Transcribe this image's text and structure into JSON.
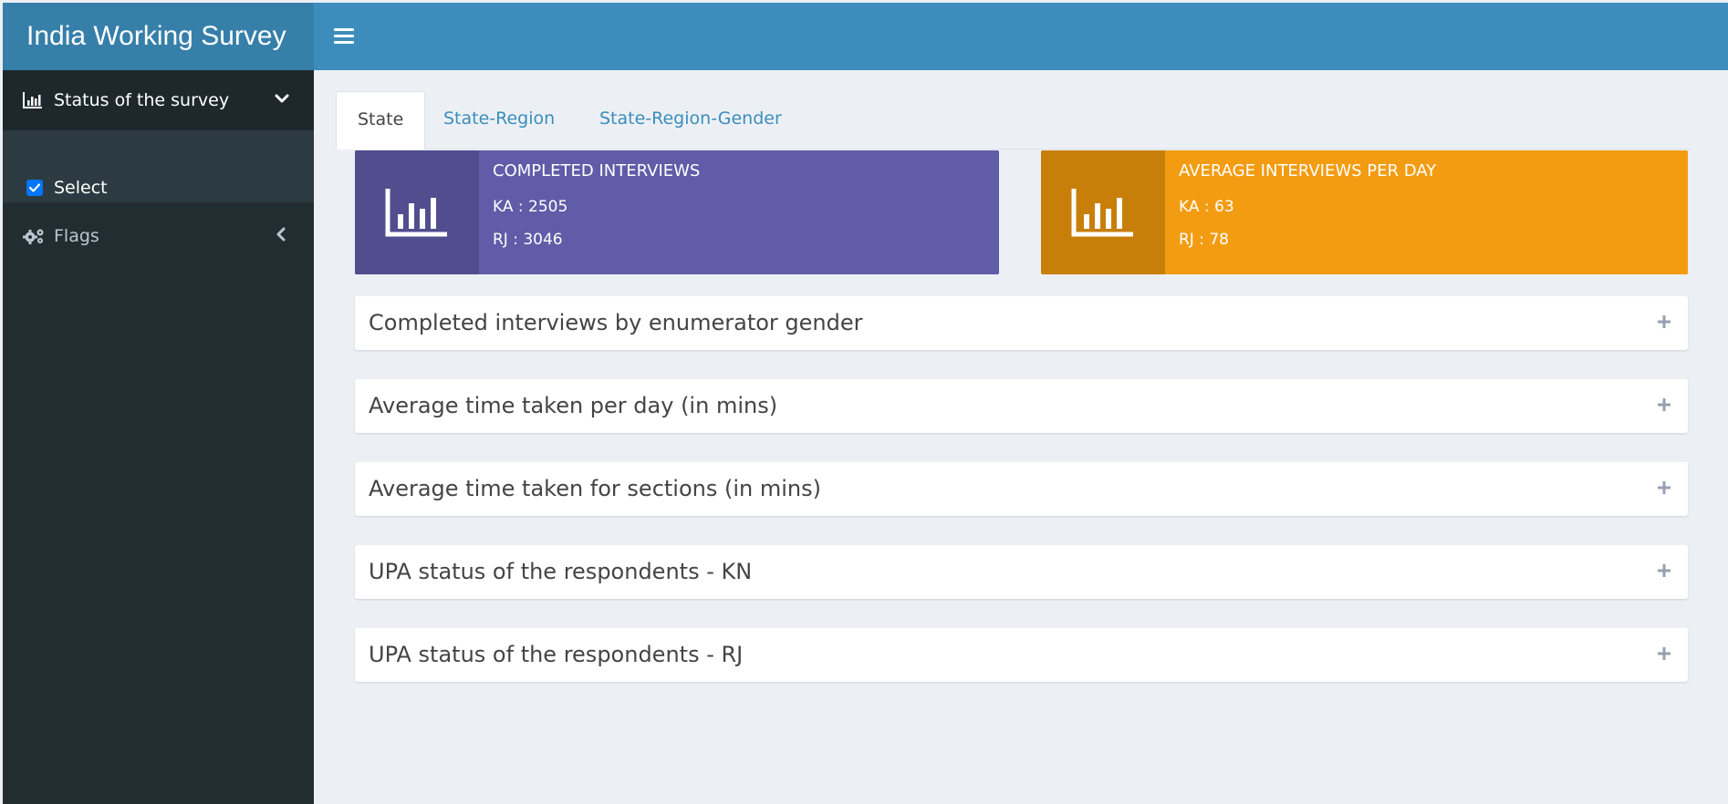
{
  "app": {
    "title": "India Working Survey"
  },
  "sidebar": {
    "items": [
      {
        "label": "Status of the survey",
        "icon": "bar-chart-icon",
        "expanded": true
      },
      {
        "label": "Flags",
        "icon": "gears-icon",
        "expanded": false
      }
    ],
    "submenu": {
      "checkbox_label": "Select",
      "checked": true
    }
  },
  "tabs": [
    {
      "label": "State",
      "active": true
    },
    {
      "label": "State-Region",
      "active": false
    },
    {
      "label": "State-Region-Gender",
      "active": false
    }
  ],
  "infoboxes": [
    {
      "title": "Completed interviews",
      "lines": [
        "KA : 2505",
        "RJ : 3046"
      ],
      "color": "#605ca8",
      "icon_bg": "#514d8f",
      "icon": "bar-chart-icon"
    },
    {
      "title": "Average interviews per day",
      "lines": [
        "KA : 63",
        "RJ : 78"
      ],
      "color": "#f39c12",
      "icon_bg": "#c87f0a",
      "icon": "bar-chart-icon"
    }
  ],
  "boxes": [
    {
      "title": "Completed interviews by enumerator gender"
    },
    {
      "title": "Average time taken per day (in mins)"
    },
    {
      "title": "Average time taken for sections (in mins)"
    },
    {
      "title": "UPA status of the respondents - KN"
    },
    {
      "title": "UPA status of the respondents - RJ"
    }
  ],
  "colors": {
    "header": "#3c8dbc",
    "logo": "#367fa9",
    "sidebar": "#222d32",
    "content_bg": "#ecf0f5"
  }
}
